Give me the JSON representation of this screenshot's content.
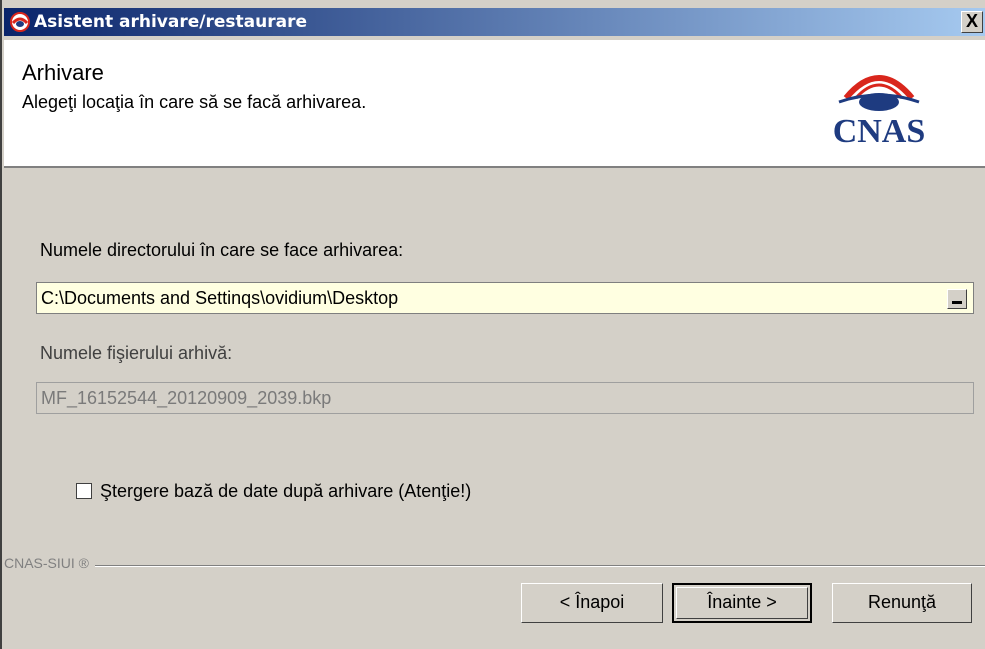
{
  "window": {
    "title": "Asistent arhivare/restaurare",
    "close_label": "X"
  },
  "header": {
    "title": "Arhivare",
    "subtitle": "Alegeţi locaţia în care să se facă arhivarea.",
    "logo_text": "CNAS"
  },
  "form": {
    "dir_label": "Numele directorului în care se face arhivarea:",
    "dir_value": "C:\\Documents and Settinqs\\ovidium\\Desktop",
    "file_label": "Numele fişierului arhivă:",
    "file_value": "MF_16152544_20120909_2039.bkp",
    "delete_label": "Ştergere bază de date după arhivare (Atenţie!)",
    "delete_checked": false
  },
  "footer": {
    "brand": "CNAS-SIUI ®",
    "back_label": "< Înapoi",
    "next_label": "Înainte >",
    "cancel_label": "Renunţă"
  },
  "colors": {
    "titlebar_start": "#0a246a",
    "titlebar_end": "#a6caf0",
    "logo_red": "#d9261c",
    "logo_blue": "#1e3b80",
    "field_bg": "#ffffe1"
  }
}
